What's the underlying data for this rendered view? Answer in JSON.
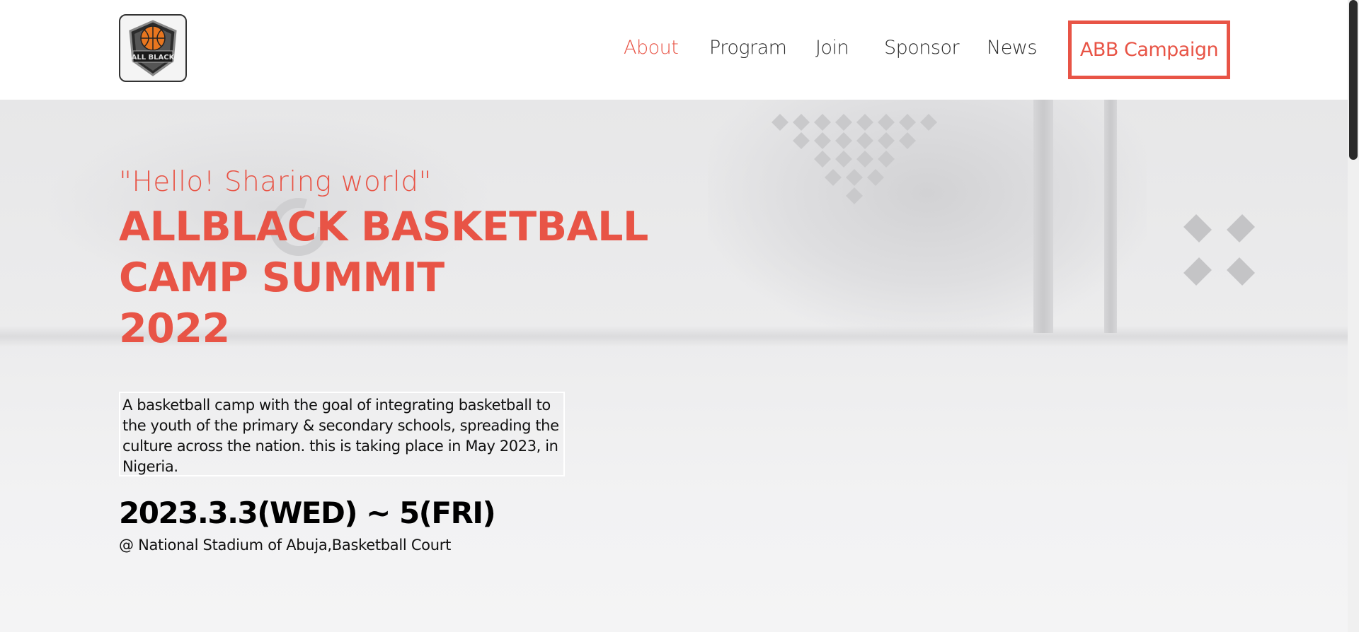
{
  "header": {
    "logo_text": "ALL BLACK",
    "nav": [
      {
        "label": "About",
        "active": true
      },
      {
        "label": "Program",
        "active": false
      },
      {
        "label": "Join",
        "active": false
      },
      {
        "label": "Sponsor",
        "active": false
      },
      {
        "label": "News",
        "active": false
      }
    ],
    "cta_label": "ABB Campaign"
  },
  "hero": {
    "tagline": "\"Hello! Sharing world\"",
    "title_lines": [
      "ALLBLACK BASKETBALL",
      "CAMP SUMMIT",
      "2022"
    ],
    "description": "A basketball camp with the goal of integrating basketball to the youth of the primary & secondary schools, spreading the culture across the nation. this is taking place in May 2023, in Nigeria.",
    "date": "2023.3.3(WED) ~ 5(FRI)",
    "venue": "@ National Stadium of Abuja,Basketball Court"
  },
  "colors": {
    "accent": "#e85446",
    "text": "#111111",
    "hero_bg": "#ececed"
  },
  "icons": {
    "logo": "basketball-shield-icon",
    "decor_diamonds": "diamond-pattern-icon",
    "decor_x": "x-mark-icon"
  }
}
